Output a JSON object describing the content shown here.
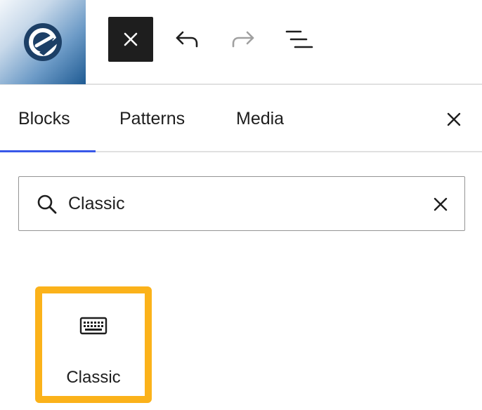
{
  "toolbar": {
    "logo_icon": "site-logo-icon",
    "close_icon": "close-icon",
    "undo_icon": "undo-icon",
    "redo_icon": "redo-icon",
    "list_view_icon": "list-view-icon"
  },
  "tabs": [
    {
      "label": "Blocks",
      "active": true
    },
    {
      "label": "Patterns",
      "active": false
    },
    {
      "label": "Media",
      "active": false
    }
  ],
  "search": {
    "value": "Classic",
    "search_icon": "search-icon",
    "clear_icon": "close-icon"
  },
  "results": [
    {
      "label": "Classic",
      "icon": "keyboard-icon",
      "highlight_color": "#fbb21a"
    }
  ],
  "colors": {
    "accent": "#3858e9",
    "highlight": "#fbb21a",
    "dark": "#1e1e1e"
  }
}
